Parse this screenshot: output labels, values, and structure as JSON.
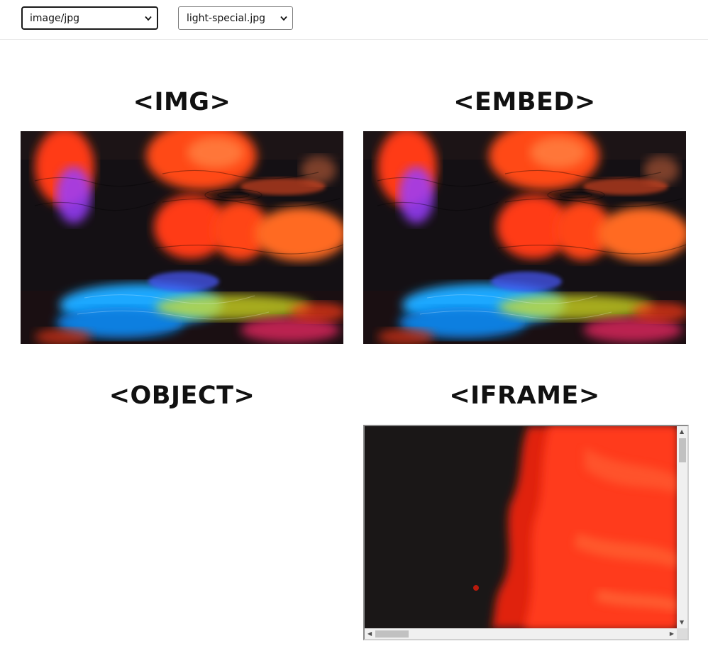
{
  "toolbar": {
    "type_select": {
      "value": "image/jpg"
    },
    "file_select": {
      "value": "light-special.jpg"
    }
  },
  "sections": {
    "img": {
      "heading": "<IMG>"
    },
    "embed": {
      "heading": "<EMBED>"
    },
    "object": {
      "heading": "<OBJECT>"
    },
    "iframe": {
      "heading": "<IFRAME>"
    }
  },
  "icons": {
    "select_arrow": "chevron-down-icon",
    "scroll_up": "arrow-up-icon",
    "scroll_down": "arrow-down-icon",
    "scroll_left": "arrow-left-icon",
    "scroll_right": "arrow-right-icon"
  },
  "colors": {
    "photo_background": "#141014",
    "photo_red": "#ff3a12",
    "photo_orange": "#ff6a20",
    "photo_blue": "#1aa8ff",
    "photo_yellow": "#d6e020",
    "photo_purple": "#9a3cff"
  }
}
